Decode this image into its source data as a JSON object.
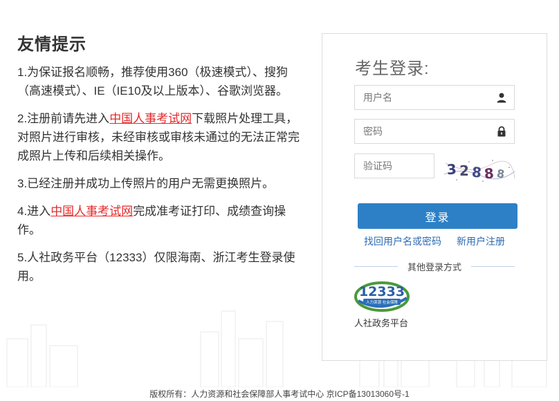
{
  "notice": {
    "title": "友情提示",
    "item1": "1.为保证报名顺畅，推荐使用360（极速模式）、搜狗（高速模式）、IE（IE10及以上版本）、谷歌浏览器。",
    "item2_pre": "2.注册前请先进入",
    "item2_link": "中国人事考试网",
    "item2_post": "下载照片处理工具，对照片进行审核，未经审核或审核未通过的无法正常完成照片上传和后续相关操作。",
    "item3": "3.已经注册并成功上传照片的用户无需更换照片。",
    "item4_pre": "4.进入",
    "item4_link": "中国人事考试网",
    "item4_post": "完成准考证打印、成绩查询操作。",
    "item5": "5.人社政务平台（12333）仅限海南、浙江考生登录使用。"
  },
  "login": {
    "title": "考生登录:",
    "username_placeholder": "用户名",
    "password_placeholder": "密码",
    "captcha_placeholder": "验证码",
    "captcha_text": "32888",
    "submit_label": "登录",
    "recover_link": "找回用户名或密码",
    "register_link": "新用户注册",
    "other_methods": "其他登录方式",
    "platform_logo_number": "12333",
    "platform_logo_caption": "人力资源 社会保障",
    "platform_label": "人社政务平台"
  },
  "footer": {
    "text": "版权所有：人力资源和社会保障部人事考试中心 京ICP备13013060号-1"
  },
  "colors": {
    "accent": "#2d80c6",
    "link": "#2d6bb3",
    "highlight": "#e4292a"
  },
  "icons": {
    "user": "user-icon",
    "lock": "lock-icon"
  }
}
